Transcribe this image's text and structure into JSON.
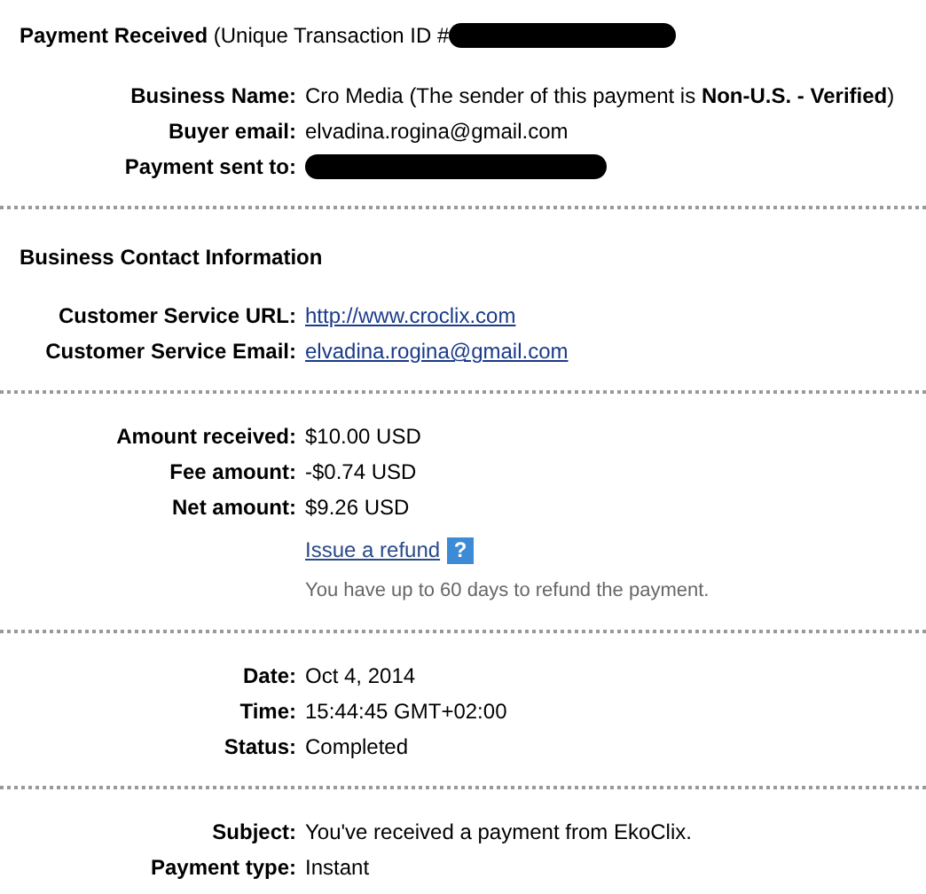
{
  "title": {
    "text": "**Payment Received** (Unique Transaction ID #",
    "redacted": true
  },
  "sections": [
    {
      "rows": [
        {
          "label": "Business Name:",
          "value": "Cro Media (The sender of this payment is **Non-U.S. - Verified**)",
          "kind": "text"
        },
        {
          "label": "Buyer email:",
          "value": "elvadina.rogina@gmail.com",
          "kind": "text"
        },
        {
          "label": "Payment sent to:",
          "kind": "redacted"
        }
      ]
    },
    {
      "heading": "Business Contact Information",
      "rows": [
        {
          "label": "Customer Service URL:",
          "value": "http://www.croclix.com",
          "kind": "link"
        },
        {
          "label": "Customer Service Email:",
          "value": "elvadina.rogina@gmail.com",
          "kind": "link"
        }
      ]
    },
    {
      "rows": [
        {
          "label": "Amount received:",
          "value": "$10.00 USD",
          "kind": "text"
        },
        {
          "label": "Fee amount:",
          "value": "-$0.74 USD",
          "kind": "text"
        },
        {
          "label": "Net amount:",
          "value": "$9.26 USD",
          "kind": "text"
        },
        {
          "value": "Issue a refund",
          "kind": "refund",
          "help": "?"
        },
        {
          "value": "You have up to 60 days to refund the payment.",
          "kind": "note"
        }
      ]
    },
    {
      "rows": [
        {
          "label": "Date:",
          "value": "Oct 4, 2014",
          "kind": "text"
        },
        {
          "label": "Time:",
          "value": "15:44:45 GMT+02:00",
          "kind": "text"
        },
        {
          "label": "Status:",
          "value": "Completed",
          "kind": "text"
        }
      ]
    },
    {
      "rows": [
        {
          "label": "Subject:",
          "value": "You've received a payment from EkoClix.",
          "kind": "text"
        },
        {
          "label": "Payment type:",
          "value": "Instant",
          "kind": "text"
        }
      ]
    }
  ]
}
